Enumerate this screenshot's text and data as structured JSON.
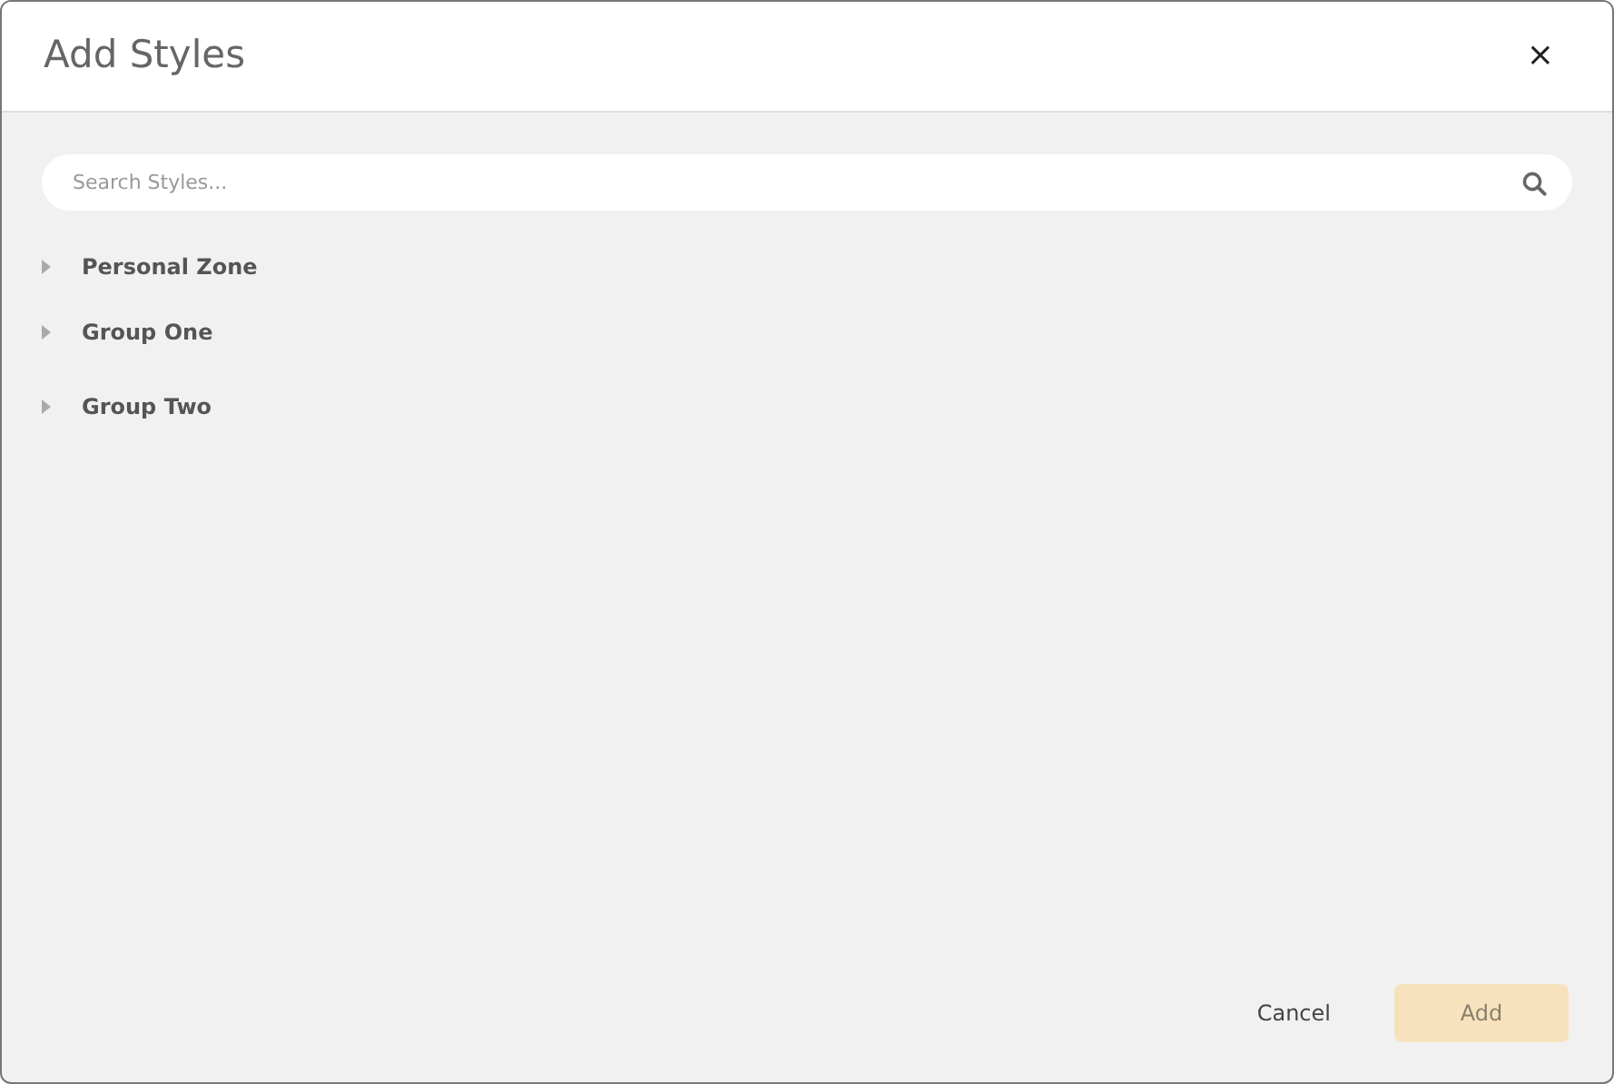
{
  "dialog": {
    "title": "Add Styles",
    "close": "×"
  },
  "search": {
    "placeholder": "Search Styles..."
  },
  "tree": [
    {
      "label": "Personal Zone",
      "expanded": false
    },
    {
      "label": "Group One",
      "expanded": false
    },
    {
      "label": "Group Two",
      "expanded": false
    }
  ],
  "buttons": [
    {
      "label": "Cancel",
      "kind": "link",
      "disabled": false
    },
    {
      "label": "Add",
      "kind": "primary",
      "disabled": true
    }
  ]
}
